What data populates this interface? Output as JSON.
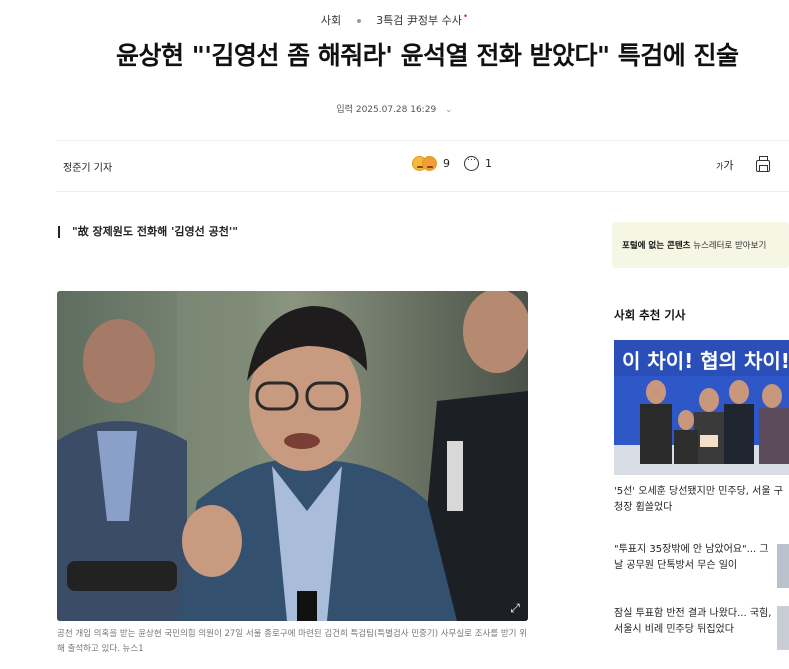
{
  "breadcrumb": {
    "section": "사회",
    "topic": "3특검 尹정부 수사",
    "topic_dot": "•"
  },
  "article": {
    "headline": "윤상현 \"'김영선 좀 해줘라' 윤석열 전화 받았다\" 특검에 진술",
    "date_label": "입력",
    "date": "2025.07.28 16:29",
    "date_chevron": "⌄",
    "reporter": "정준기 기자",
    "reactions_count": "9",
    "comments_count": "1",
    "font_size_glyph": "가",
    "font_size_glyph_small": "가",
    "subheading": "\"故 장제원도 전화해 '김영선 공천'\"",
    "photo_caption": "공천 개입 의혹을 받는 윤상현 국민의힘 의원이 27일 서울 종로구에 마련된 김건희 특검팀(특별검사 민중기) 사무실로 조사를 받기 위해 출석하고 있다. 뉴스1",
    "expand_glyph": "⤢"
  },
  "promo": {
    "bold": "포털에 없는 콘텐츠",
    "text": "뉴스레터로 받아보기"
  },
  "recommended": {
    "title": "사회 추천 기사",
    "image_banner_text": "이 차이! 협의 차이!",
    "items": [
      {
        "text": "'5선' 오세훈 당선됐지만 민주당, 서울 구청장 휩쓸었다"
      },
      {
        "text": "\"투표지 35장밖에 안 남았어요\"... 그날 공무원 단톡방서 무슨 일이"
      },
      {
        "text": "잠실 투표함 반전 결과 나왔다... 국힘, 서울시 비례 민주당 뒤집었다"
      }
    ]
  },
  "colors": {
    "topic_dot": "#e0322b",
    "promo_bg": "#f5f6e4",
    "banner_blue": "#2e57c8"
  },
  "icons": {
    "reaction": "emoji-faces-icon",
    "comment": "comment-bubble-icon",
    "font_size": "font-size-icon",
    "print": "print-icon",
    "expand": "expand-icon",
    "chevron": "chevron-down-icon"
  }
}
